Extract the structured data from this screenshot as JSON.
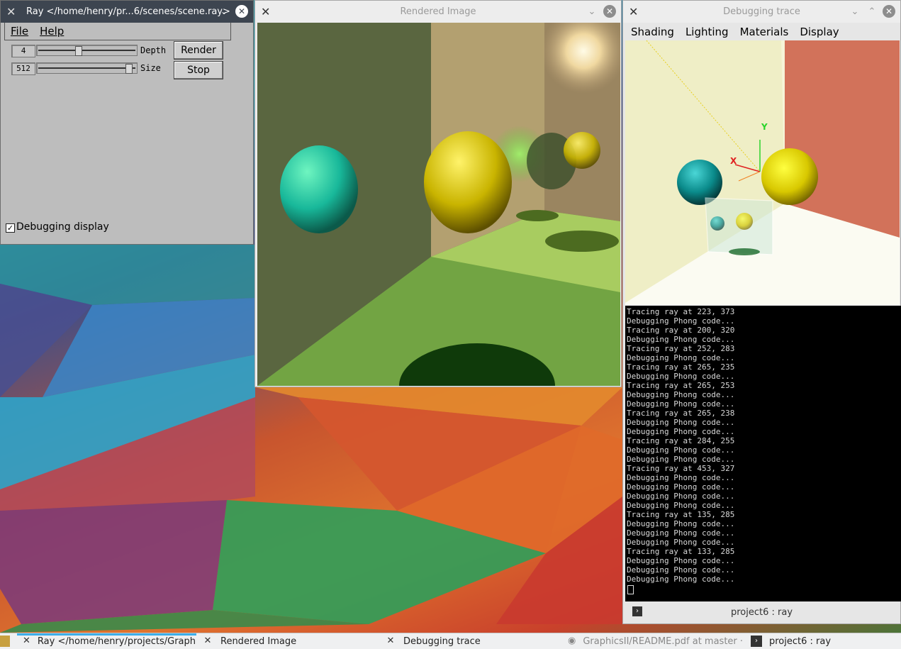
{
  "ray_window": {
    "title": "Ray </home/henry/pr...6/scenes/scene.ray>",
    "menu": [
      "File",
      "Help"
    ],
    "depth": {
      "value": "4",
      "label": "Depth",
      "level": 0.4
    },
    "size": {
      "value": "512",
      "label": "Size",
      "level": 0.95
    },
    "render_button": "Render",
    "stop_button": "Stop",
    "debug_checkbox": {
      "label": "Debugging display",
      "checked": true
    }
  },
  "render_window": {
    "title": "Rendered Image"
  },
  "trace_window": {
    "title": "Debugging trace",
    "menu": [
      "Shading",
      "Lighting",
      "Materials",
      "Display"
    ],
    "axes": {
      "x": "X",
      "y": "Y"
    },
    "console_lines": [
      "Tracing ray at 223, 373",
      "Debugging Phong code...",
      "Tracing ray at 200, 320",
      "Debugging Phong code...",
      "Tracing ray at 252, 283",
      "Debugging Phong code...",
      "Tracing ray at 265, 235",
      "Debugging Phong code...",
      "Tracing ray at 265, 253",
      "Debugging Phong code...",
      "Debugging Phong code...",
      "Tracing ray at 265, 238",
      "Debugging Phong code...",
      "Debugging Phong code...",
      "Tracing ray at 284, 255",
      "Debugging Phong code...",
      "Debugging Phong code...",
      "Tracing ray at 453, 327",
      "Debugging Phong code...",
      "Debugging Phong code...",
      "Debugging Phong code...",
      "Debugging Phong code...",
      "Tracing ray at 135, 285",
      "Debugging Phong code...",
      "Debugging Phong code...",
      "Debugging Phong code...",
      "Tracing ray at 133, 285",
      "Debugging Phong code...",
      "Debugging Phong code...",
      "Debugging Phong code..."
    ],
    "session_label": "project6 : ray"
  },
  "taskbar": {
    "tasks": [
      {
        "label": "Ray </home/henry/projects/GraphicsII",
        "icon": "x-app-icon",
        "active": true
      },
      {
        "label": "Rendered Image",
        "icon": "x-app-icon",
        "active": false
      },
      {
        "label": "Debugging trace",
        "icon": "x-app-icon",
        "active": false
      },
      {
        "label": "GraphicsII/README.pdf at master · He",
        "icon": "browser-icon",
        "active": false
      },
      {
        "label": "project6 : ray",
        "icon": "terminal-icon",
        "active": false
      }
    ]
  },
  "colors": {
    "titlebar_dark": "#3d4550",
    "accent": "#3daee9",
    "widget_grey": "#bdbdbd"
  }
}
